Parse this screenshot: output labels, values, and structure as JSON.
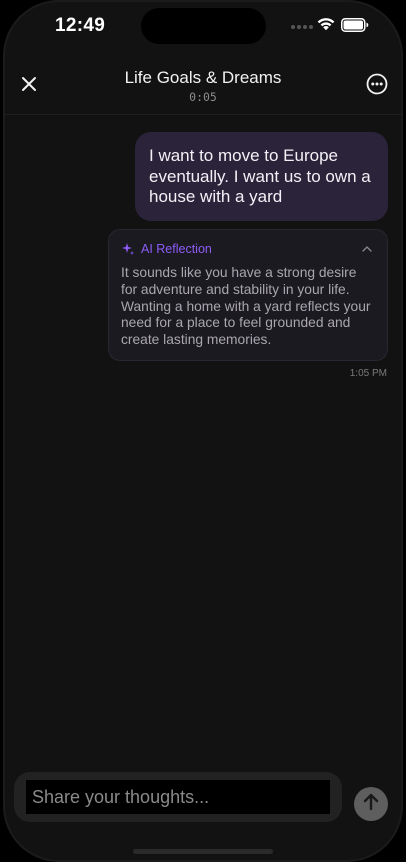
{
  "status_bar": {
    "time": "12:49",
    "icons": [
      "cellular-dots-icon",
      "wifi-icon",
      "battery-icon"
    ]
  },
  "header": {
    "title": "Life Goals & Dreams",
    "timer": "0:05",
    "close_icon": "close-icon",
    "more_icon": "more-options-icon"
  },
  "chat": {
    "user_message": "I want to move to Europe eventually. I want us to own a house with a yard",
    "reflection": {
      "label": "AI Reflection",
      "icon": "sparkle-icon",
      "text": "It sounds like you have a strong desire for adventure and stability in your life. Wanting a home with a yard reflects your need for a place to feel grounded and create lasting memories."
    },
    "timestamp": "1:05 PM"
  },
  "composer": {
    "placeholder": "Share your thoughts...",
    "value": "",
    "send_icon": "arrow-up-icon"
  },
  "colors": {
    "background": "#121212",
    "user_bubble": "#2a2339",
    "accent": "#8b5cf6",
    "reflection_card": "#1c1a21"
  }
}
